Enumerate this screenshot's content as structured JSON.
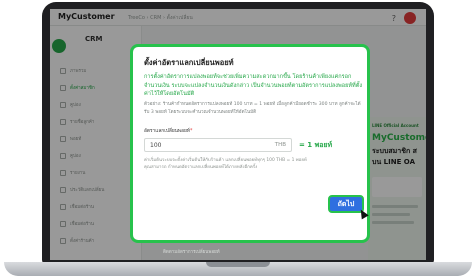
{
  "app": {
    "name": "MyCustomer",
    "breadcrumb": "TreeCo › CRM › ตั้งค่าเปลี่ยน"
  },
  "sidebar": {
    "title": "CRM",
    "items": [
      {
        "label": "ภาพรวม",
        "active": false
      },
      {
        "label": "ตั้งค่าสมาชิก",
        "active": true
      },
      {
        "label": "คูปอง",
        "active": false
      },
      {
        "label": "รายชื่อลูกค้า",
        "active": false
      },
      {
        "label": "พอยท์",
        "active": false
      },
      {
        "label": "คูปอง",
        "active": false
      },
      {
        "label": "รายงาน",
        "active": false
      },
      {
        "label": "ประวัติแลกเปลี่ยน",
        "active": false
      },
      {
        "label": "เชื่อมต่อร้าน",
        "active": false
      },
      {
        "label": "เชื่อมต่อร้าน",
        "active": false
      },
      {
        "label": "ตั้งค่าร้านค้า",
        "active": false
      }
    ]
  },
  "promo": {
    "tag": "LINE Official Account",
    "heading": "MyCustome",
    "line1": "ระบบสมาชิก ส",
    "line2": "บน LINE OA"
  },
  "overlay": {
    "footer": "ติดตามอัตราการเปลี่ยนพอยท์"
  },
  "modal": {
    "title": "ตั้งค่าอัตราแลกเปลี่ยนพอยท์",
    "intro": "การตั้งค่าอัตราการแปลงพอยท์จะช่วยเพิ่มความสะดวกมากขึ้น โดยร้านค้าเพียงแค่กรอกจำนวนเงิน ระบบจะแปลงจำนวนเงินดังกล่าว เป็นจำนวนพอยท์ตามอัตราการแปลงพอยท์ที่ตั้งค่าไว้ให้โดยอัตโนมัติ",
    "example": "ตัวอย่าง: ร้านค้ากำหนดอัตราการแปลงพอยท์ 100 บาท = 1 พอยท์ เมื่อลูกค้ามียอดชำระ 300 บาท ลูกค้าจะได้รับ 3 พอยท์ โดยระบบจะคำนวณจำนวนพอยท์ให้อัตโนมัติ",
    "field_label": "อัตราแลกเปลี่ยนพอยท์",
    "required_mark": "*",
    "input_value": "100",
    "input_unit": "THB",
    "equals_text": "= 1 พอยท์",
    "help": "ค่าเริ่มต้นระบบจะตั้งค่าเริ่มต้นให้กับร้านค้า แลกเปลี่ยนพอยท์ทุกๆ 100 THB = 1 พอยท์ คุณสามารถ กำหนดอัตราแลกเปลี่ยนพอยท์ได้ภายหลังอีกครั้ง",
    "next_label": "ถัดไป"
  }
}
